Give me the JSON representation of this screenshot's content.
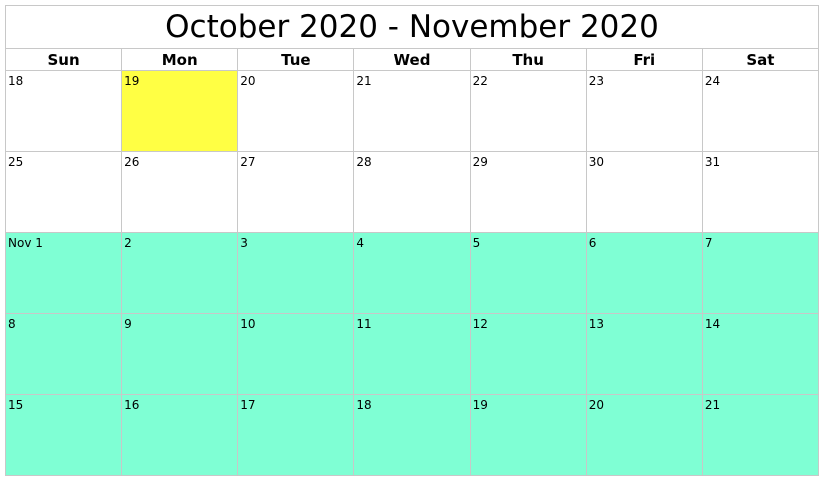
{
  "title": "October 2020 - November 2020",
  "weekdays": [
    "Sun",
    "Mon",
    "Tue",
    "Wed",
    "Thu",
    "Fri",
    "Sat"
  ],
  "colors": {
    "today": "#ffff44",
    "next_month": "#7fffd4",
    "current_month": "#ffffff",
    "grid": "#c8c8c8"
  },
  "weeks": [
    [
      {
        "label": "18",
        "state": "current"
      },
      {
        "label": "19",
        "state": "today"
      },
      {
        "label": "20",
        "state": "current"
      },
      {
        "label": "21",
        "state": "current"
      },
      {
        "label": "22",
        "state": "current"
      },
      {
        "label": "23",
        "state": "current"
      },
      {
        "label": "24",
        "state": "current"
      }
    ],
    [
      {
        "label": "25",
        "state": "current"
      },
      {
        "label": "26",
        "state": "current"
      },
      {
        "label": "27",
        "state": "current"
      },
      {
        "label": "28",
        "state": "current"
      },
      {
        "label": "29",
        "state": "current"
      },
      {
        "label": "30",
        "state": "current"
      },
      {
        "label": "31",
        "state": "current"
      }
    ],
    [
      {
        "label": "Nov 1",
        "state": "next"
      },
      {
        "label": "2",
        "state": "next"
      },
      {
        "label": "3",
        "state": "next"
      },
      {
        "label": "4",
        "state": "next"
      },
      {
        "label": "5",
        "state": "next"
      },
      {
        "label": "6",
        "state": "next"
      },
      {
        "label": "7",
        "state": "next"
      }
    ],
    [
      {
        "label": "8",
        "state": "next"
      },
      {
        "label": "9",
        "state": "next"
      },
      {
        "label": "10",
        "state": "next"
      },
      {
        "label": "11",
        "state": "next"
      },
      {
        "label": "12",
        "state": "next"
      },
      {
        "label": "13",
        "state": "next"
      },
      {
        "label": "14",
        "state": "next"
      }
    ],
    [
      {
        "label": "15",
        "state": "next"
      },
      {
        "label": "16",
        "state": "next"
      },
      {
        "label": "17",
        "state": "next"
      },
      {
        "label": "18",
        "state": "next"
      },
      {
        "label": "19",
        "state": "next"
      },
      {
        "label": "20",
        "state": "next"
      },
      {
        "label": "21",
        "state": "next"
      }
    ]
  ]
}
